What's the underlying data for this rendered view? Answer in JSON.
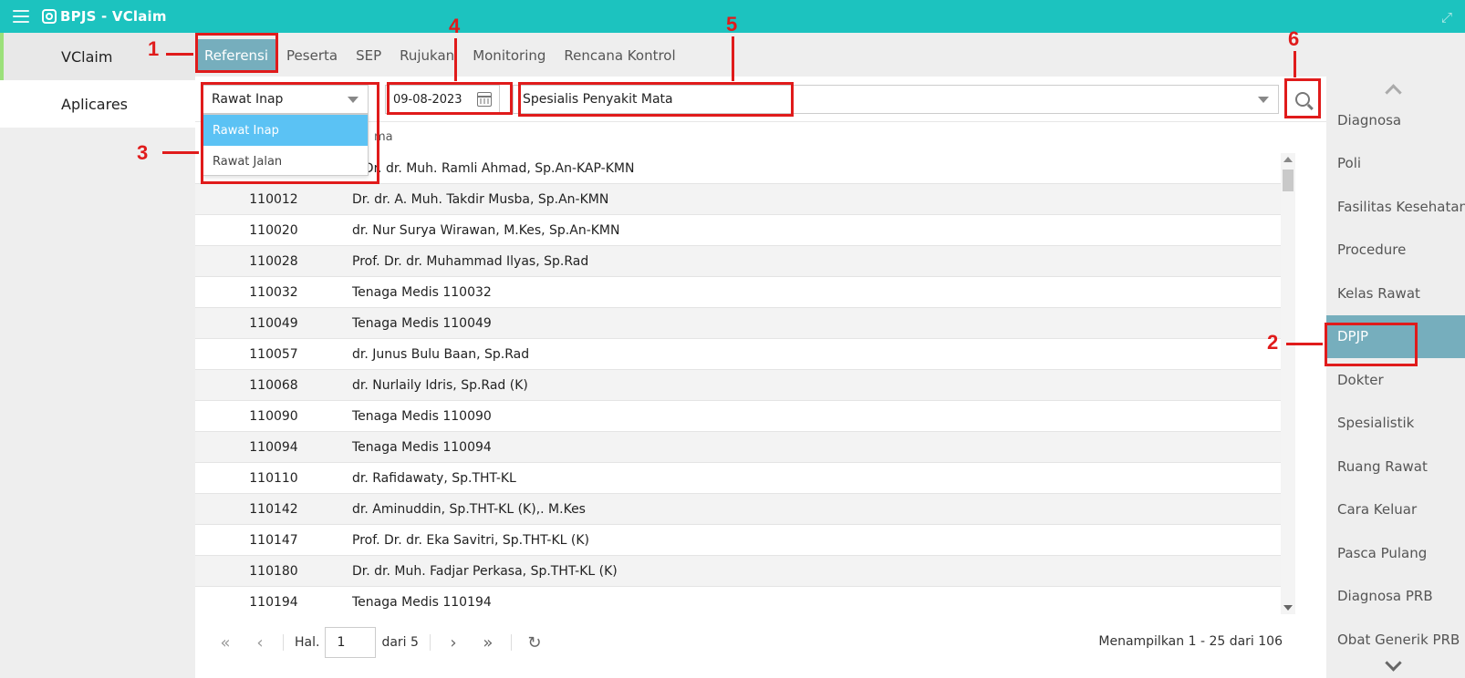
{
  "app": {
    "title": "BPJS - VClaim"
  },
  "leftnav": {
    "items": [
      {
        "label": "VClaim"
      },
      {
        "label": "Aplicares"
      }
    ]
  },
  "tabs": [
    {
      "label": "Referensi"
    },
    {
      "label": "Peserta"
    },
    {
      "label": "SEP"
    },
    {
      "label": "Rujukan"
    },
    {
      "label": "Monitoring"
    },
    {
      "label": "Rencana Kontrol"
    }
  ],
  "filter": {
    "jenis_pelayanan": "Rawat Inap",
    "tanggal": "09-08-2023",
    "spesialis": "Spesialis Penyakit Mata",
    "dropdown_options": [
      "Rawat Inap",
      "Rawat Jalan"
    ]
  },
  "table": {
    "header_nama_partial": "ma",
    "rows": [
      {
        "kode": "",
        "nama": "f. Dr. dr. Muh. Ramli Ahmad, Sp.An-KAP-KMN"
      },
      {
        "kode": "110012",
        "nama": "Dr. dr. A. Muh. Takdir Musba, Sp.An-KMN"
      },
      {
        "kode": "110020",
        "nama": "dr. Nur Surya Wirawan, M.Kes, Sp.An-KMN"
      },
      {
        "kode": "110028",
        "nama": "Prof. Dr. dr. Muhammad Ilyas, Sp.Rad"
      },
      {
        "kode": "110032",
        "nama": "Tenaga Medis 110032"
      },
      {
        "kode": "110049",
        "nama": "Tenaga Medis 110049"
      },
      {
        "kode": "110057",
        "nama": "dr. Junus Bulu Baan, Sp.Rad"
      },
      {
        "kode": "110068",
        "nama": "dr. Nurlaily Idris, Sp.Rad (K)"
      },
      {
        "kode": "110090",
        "nama": "Tenaga Medis 110090"
      },
      {
        "kode": "110094",
        "nama": "Tenaga Medis 110094"
      },
      {
        "kode": "110110",
        "nama": "dr. Rafidawaty, Sp.THT-KL"
      },
      {
        "kode": "110142",
        "nama": "dr. Aminuddin, Sp.THT-KL (K),. M.Kes"
      },
      {
        "kode": "110147",
        "nama": "Prof. Dr. dr. Eka Savitri, Sp.THT-KL (K)"
      },
      {
        "kode": "110180",
        "nama": "Dr. dr. Muh. Fadjar Perkasa, Sp.THT-KL (K)"
      },
      {
        "kode": "110194",
        "nama": "Tenaga Medis 110194"
      }
    ]
  },
  "pager": {
    "hal_label": "Hal.",
    "page": "1",
    "dari_label": "dari 5",
    "info": "Menampilkan 1 - 25 dari 106"
  },
  "rightnav": {
    "items": [
      {
        "label": "Diagnosa"
      },
      {
        "label": "Poli"
      },
      {
        "label": "Fasilitas Kesehatan"
      },
      {
        "label": "Procedure"
      },
      {
        "label": "Kelas Rawat"
      },
      {
        "label": "DPJP"
      },
      {
        "label": "Dokter"
      },
      {
        "label": "Spesialistik"
      },
      {
        "label": "Ruang Rawat"
      },
      {
        "label": "Cara Keluar"
      },
      {
        "label": "Pasca Pulang"
      },
      {
        "label": "Diagnosa PRB"
      },
      {
        "label": "Obat Generik PRB"
      }
    ]
  },
  "annotations": {
    "labels": [
      "1",
      "2",
      "3",
      "4",
      "5",
      "6"
    ],
    "color": "#e01b1b"
  },
  "colors": {
    "topbar": "#1cc3bf",
    "active_tab": "#76aebd",
    "dropdown_selected": "#5bc2f4"
  }
}
